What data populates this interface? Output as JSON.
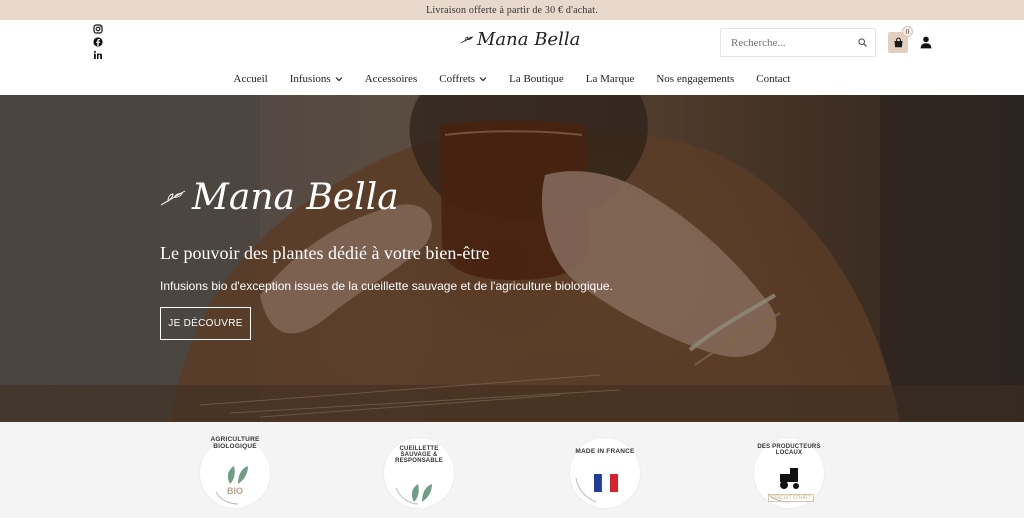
{
  "topbar": {
    "text": "Livraison offerte à partir de 30 € d'achat."
  },
  "header": {
    "socials": [
      "instagram-icon",
      "facebook-icon",
      "linkedin-icon"
    ],
    "logo_text": "Mana Bella",
    "search": {
      "placeholder": "Recherche..."
    },
    "cart": {
      "count": "0"
    }
  },
  "nav": {
    "items": [
      {
        "label": "Accueil",
        "dropdown": false
      },
      {
        "label": "Infusions",
        "dropdown": true
      },
      {
        "label": "Accessoires",
        "dropdown": false
      },
      {
        "label": "Coffrets",
        "dropdown": true
      },
      {
        "label": "La Boutique",
        "dropdown": false
      },
      {
        "label": "La Marque",
        "dropdown": false
      },
      {
        "label": "Nos engagements",
        "dropdown": false
      },
      {
        "label": "Contact",
        "dropdown": false
      }
    ]
  },
  "hero": {
    "logo_text": "Mana Bella",
    "tagline": "Le pouvoir des plantes dédié à votre bien-être",
    "subtitle": "Infusions bio d'exception issues de la cueillette sauvage et de l'agriculture biologique.",
    "button": "JE DÉCOUVRE"
  },
  "badges": [
    {
      "label": "AGRICULTURE BIOLOGIQUE",
      "extra": "BIO"
    },
    {
      "label": "CUEILLETTE SAUVAGE & RESPONSABLE",
      "extra": ""
    },
    {
      "label": "MADE IN FRANCE",
      "extra": ""
    },
    {
      "label": "DES PRODUCTEURS LOCAUX",
      "extra": "CIRCUIT COURT"
    }
  ],
  "colors": {
    "topbar": "#e9d9cc",
    "accent": "#e2cfc0",
    "leaf": "#6f9e86"
  }
}
